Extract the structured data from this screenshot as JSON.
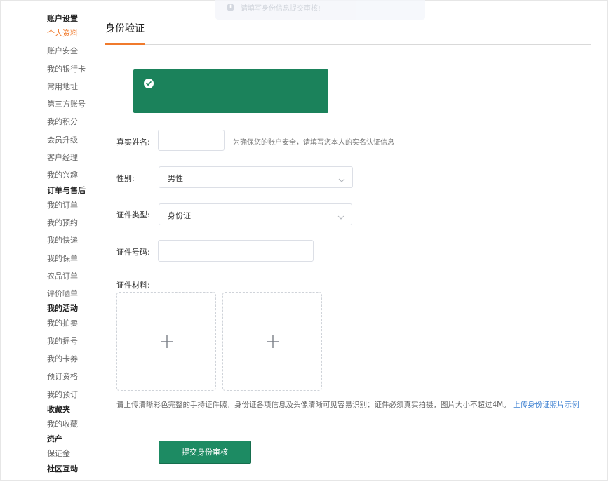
{
  "sidebar": {
    "sections": [
      {
        "title": "账户设置",
        "items": [
          "个人资料",
          "账户安全",
          "我的银行卡",
          "常用地址",
          "第三方账号",
          "我的积分",
          "会员升级",
          "客户经理",
          "我的兴趣"
        ]
      },
      {
        "title": "订单与售后",
        "items": [
          "我的订单",
          "我的预约",
          "我的快递",
          "我的保单",
          "农品订单",
          "评价晒单"
        ]
      },
      {
        "title": "我的活动",
        "items": [
          "我的拍卖",
          "我的摇号",
          "我的卡券",
          "预订资格",
          "我的预订"
        ]
      },
      {
        "title": "收藏夹",
        "items": [
          "我的收藏"
        ]
      },
      {
        "title": "资产",
        "items": [
          "保证金"
        ]
      },
      {
        "title": "社区互动",
        "items": []
      }
    ],
    "active_item": "个人资料"
  },
  "toast": {
    "text": "请填写身份信息提交审核!"
  },
  "page": {
    "title": "身份验证"
  },
  "form": {
    "name_label": "真实姓名:",
    "name_value": "",
    "name_hint": "为确保您的账户安全，请填写您本人的实名认证信息",
    "gender_label": "性别:",
    "gender_value": "男性",
    "idtype_label": "证件类型:",
    "idtype_value": "身份证",
    "idnum_label": "证件号码:",
    "idnum_value": "",
    "material_label": "证件材料:",
    "upload_desc": "请上传清晰彩色完整的手持证件照，身份证各项信息及头像清晰可见容易识别：证件必须真实拍摄，图片大小不超过4M。",
    "upload_example_link": "上传身份证照片示例",
    "submit_label": "提交身份审核"
  },
  "colors": {
    "accent": "#f07a2c",
    "primary_green": "#1b825b",
    "link": "#3b7fd1"
  }
}
